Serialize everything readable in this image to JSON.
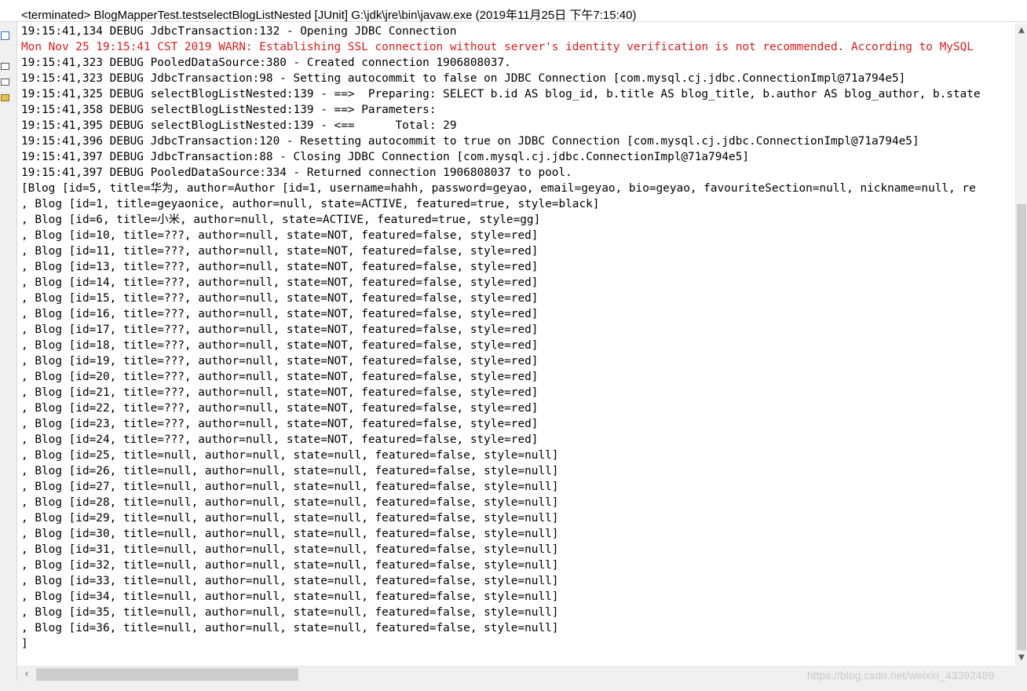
{
  "header": {
    "title": "<terminated> BlogMapperTest.testselectBlogListNested [JUnit] G:\\jdk\\jre\\bin\\javaw.exe (2019年11月25日 下午7:15:40)"
  },
  "console": {
    "lines": [
      {
        "text": "19:15:41,134 DEBUG JdbcTransaction:132 - Opening JDBC Connection",
        "type": "normal"
      },
      {
        "text": "Mon Nov 25 19:15:41 CST 2019 WARN: Establishing SSL connection without server's identity verification is not recommended. According to MySQL",
        "type": "warn"
      },
      {
        "text": "19:15:41,323 DEBUG PooledDataSource:380 - Created connection 1906808037.",
        "type": "normal"
      },
      {
        "text": "19:15:41,323 DEBUG JdbcTransaction:98 - Setting autocommit to false on JDBC Connection [com.mysql.cj.jdbc.ConnectionImpl@71a794e5]",
        "type": "normal"
      },
      {
        "text": "19:15:41,325 DEBUG selectBlogListNested:139 - ==>  Preparing: SELECT b.id AS blog_id, b.title AS blog_title, b.author AS blog_author, b.state",
        "type": "normal"
      },
      {
        "text": "19:15:41,358 DEBUG selectBlogListNested:139 - ==> Parameters: ",
        "type": "normal"
      },
      {
        "text": "19:15:41,395 DEBUG selectBlogListNested:139 - <==      Total: 29",
        "type": "normal"
      },
      {
        "text": "19:15:41,396 DEBUG JdbcTransaction:120 - Resetting autocommit to true on JDBC Connection [com.mysql.cj.jdbc.ConnectionImpl@71a794e5]",
        "type": "normal"
      },
      {
        "text": "19:15:41,397 DEBUG JdbcTransaction:88 - Closing JDBC Connection [com.mysql.cj.jdbc.ConnectionImpl@71a794e5]",
        "type": "normal"
      },
      {
        "text": "19:15:41,397 DEBUG PooledDataSource:334 - Returned connection 1906808037 to pool.",
        "type": "normal"
      },
      {
        "text": "[Blog [id=5, title=华为, author=Author [id=1, username=hahh, password=geyao, email=geyao, bio=geyao, favouriteSection=null, nickname=null, re",
        "type": "normal"
      },
      {
        "text": ", Blog [id=1, title=geyaonice, author=null, state=ACTIVE, featured=true, style=black]",
        "type": "normal"
      },
      {
        "text": ", Blog [id=6, title=小米, author=null, state=ACTIVE, featured=true, style=gg]",
        "type": "normal"
      },
      {
        "text": ", Blog [id=10, title=???, author=null, state=NOT, featured=false, style=red]",
        "type": "normal"
      },
      {
        "text": ", Blog [id=11, title=???, author=null, state=NOT, featured=false, style=red]",
        "type": "normal"
      },
      {
        "text": ", Blog [id=13, title=???, author=null, state=NOT, featured=false, style=red]",
        "type": "normal"
      },
      {
        "text": ", Blog [id=14, title=???, author=null, state=NOT, featured=false, style=red]",
        "type": "normal"
      },
      {
        "text": ", Blog [id=15, title=???, author=null, state=NOT, featured=false, style=red]",
        "type": "normal"
      },
      {
        "text": ", Blog [id=16, title=???, author=null, state=NOT, featured=false, style=red]",
        "type": "normal"
      },
      {
        "text": ", Blog [id=17, title=???, author=null, state=NOT, featured=false, style=red]",
        "type": "normal"
      },
      {
        "text": ", Blog [id=18, title=???, author=null, state=NOT, featured=false, style=red]",
        "type": "normal"
      },
      {
        "text": ", Blog [id=19, title=???, author=null, state=NOT, featured=false, style=red]",
        "type": "normal"
      },
      {
        "text": ", Blog [id=20, title=???, author=null, state=NOT, featured=false, style=red]",
        "type": "normal"
      },
      {
        "text": ", Blog [id=21, title=???, author=null, state=NOT, featured=false, style=red]",
        "type": "normal"
      },
      {
        "text": ", Blog [id=22, title=???, author=null, state=NOT, featured=false, style=red]",
        "type": "normal"
      },
      {
        "text": ", Blog [id=23, title=???, author=null, state=NOT, featured=false, style=red]",
        "type": "normal"
      },
      {
        "text": ", Blog [id=24, title=???, author=null, state=NOT, featured=false, style=red]",
        "type": "normal"
      },
      {
        "text": ", Blog [id=25, title=null, author=null, state=null, featured=false, style=null]",
        "type": "normal"
      },
      {
        "text": ", Blog [id=26, title=null, author=null, state=null, featured=false, style=null]",
        "type": "normal"
      },
      {
        "text": ", Blog [id=27, title=null, author=null, state=null, featured=false, style=null]",
        "type": "normal"
      },
      {
        "text": ", Blog [id=28, title=null, author=null, state=null, featured=false, style=null]",
        "type": "normal"
      },
      {
        "text": ", Blog [id=29, title=null, author=null, state=null, featured=false, style=null]",
        "type": "normal"
      },
      {
        "text": ", Blog [id=30, title=null, author=null, state=null, featured=false, style=null]",
        "type": "normal"
      },
      {
        "text": ", Blog [id=31, title=null, author=null, state=null, featured=false, style=null]",
        "type": "normal"
      },
      {
        "text": ", Blog [id=32, title=null, author=null, state=null, featured=false, style=null]",
        "type": "normal"
      },
      {
        "text": ", Blog [id=33, title=null, author=null, state=null, featured=false, style=null]",
        "type": "normal"
      },
      {
        "text": ", Blog [id=34, title=null, author=null, state=null, featured=false, style=null]",
        "type": "normal"
      },
      {
        "text": ", Blog [id=35, title=null, author=null, state=null, featured=false, style=null]",
        "type": "normal"
      },
      {
        "text": ", Blog [id=36, title=null, author=null, state=null, featured=false, style=null]",
        "type": "normal"
      },
      {
        "text": "]",
        "type": "normal"
      }
    ]
  },
  "icons": {
    "gutter": [
      "console-view-icon",
      "restore-icon",
      "restore-icon",
      "folder-icon"
    ],
    "scroll_up": "chevron-up-icon",
    "scroll_down": "chevron-down-icon",
    "scroll_left": "chevron-left-icon"
  },
  "colors": {
    "normal_text": "#000000",
    "warn_text": "#e01b1b",
    "background": "#ffffff",
    "scroll_track": "#f0f0f0",
    "scroll_thumb": "#cdcdcd"
  },
  "watermark": "https://blog.csdn.net/weixin_43392489"
}
